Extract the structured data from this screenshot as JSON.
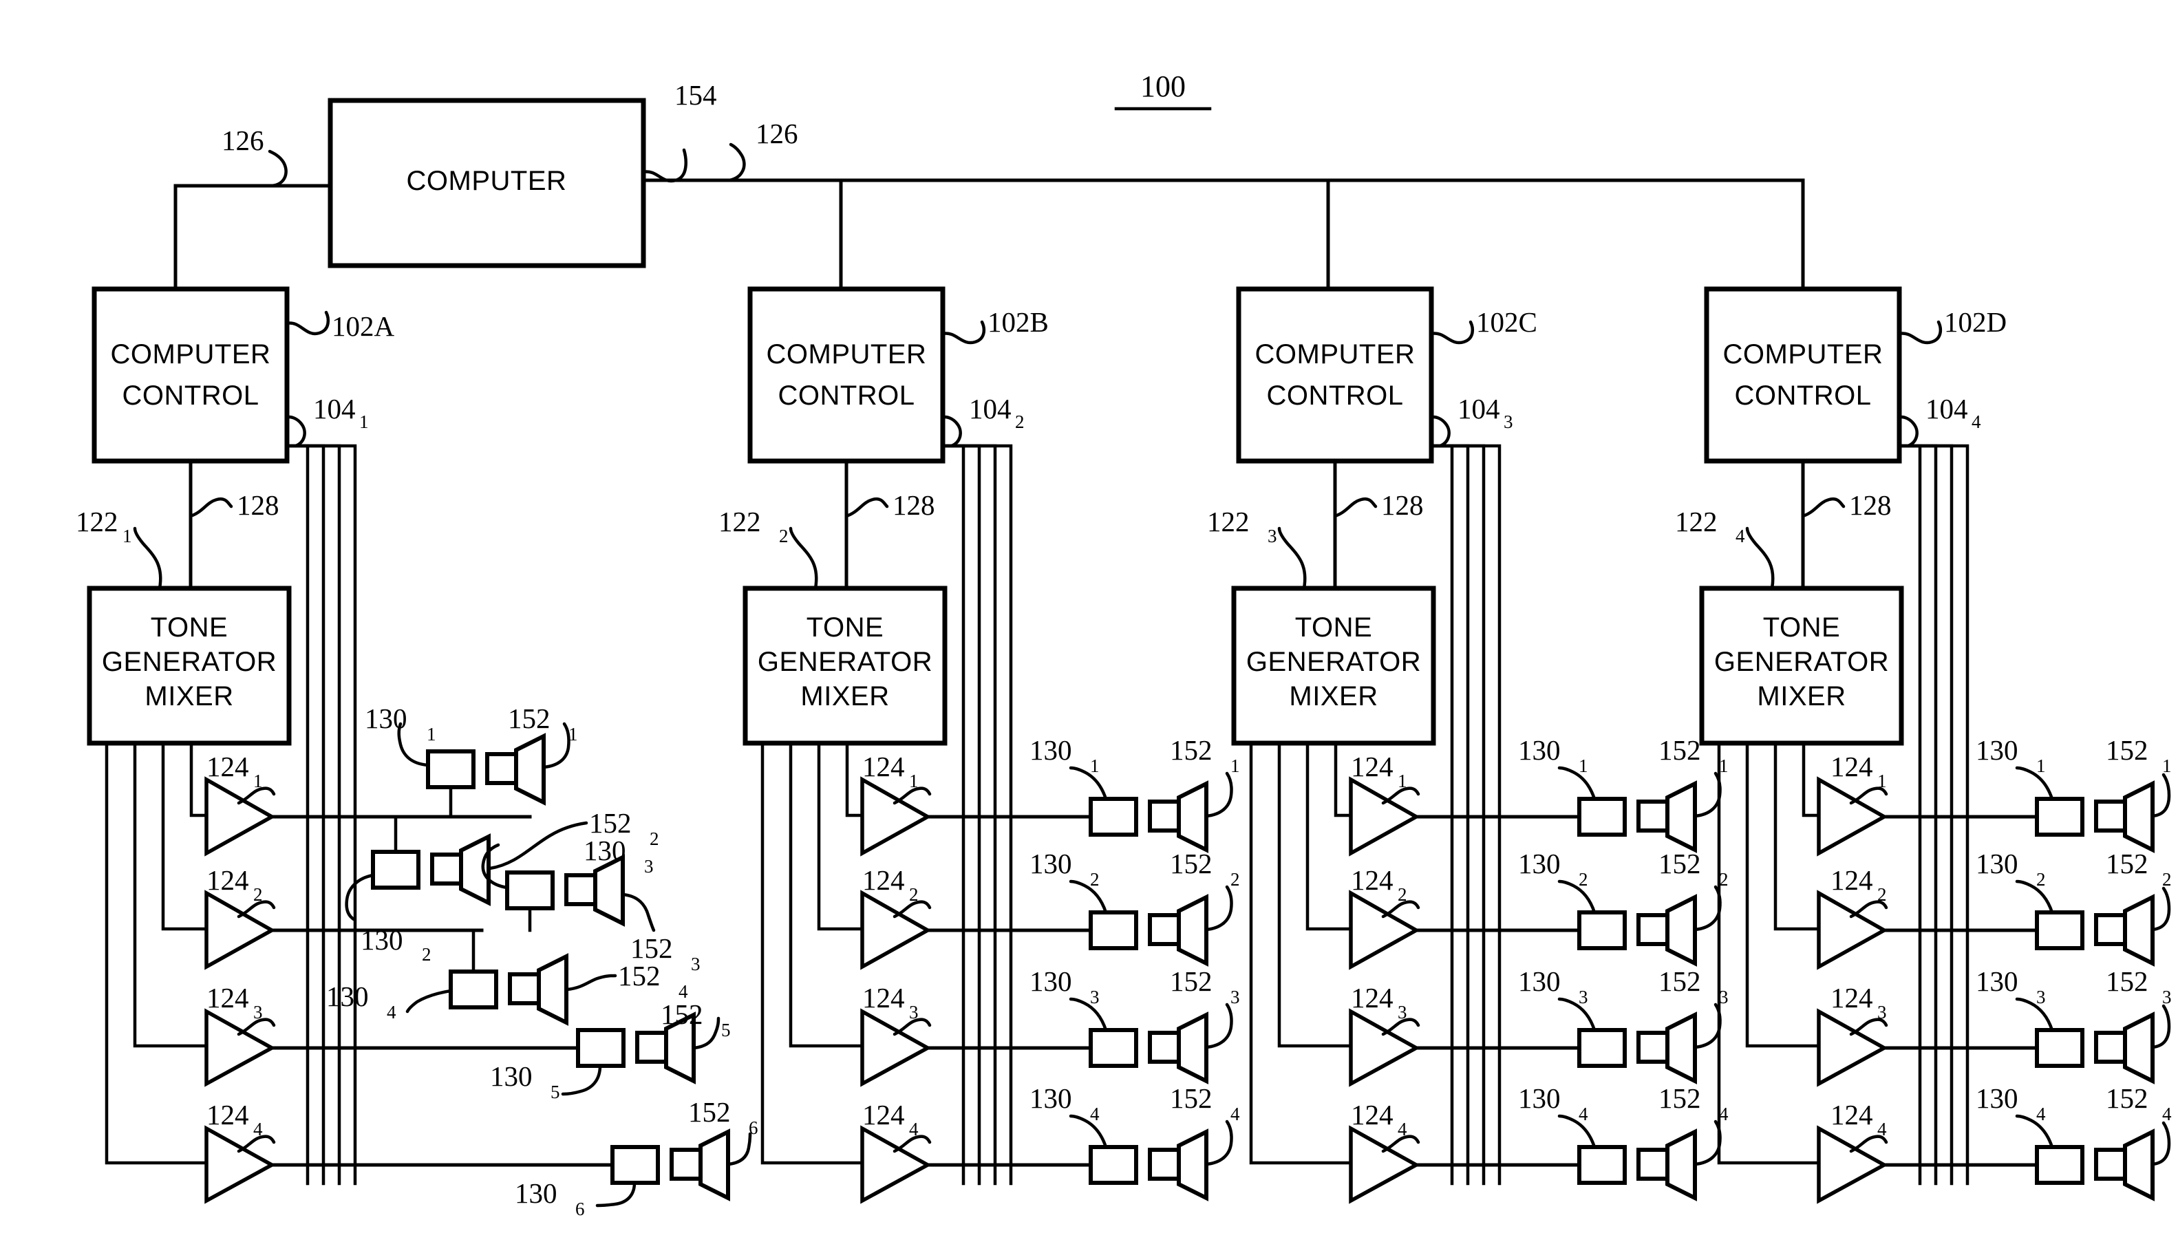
{
  "figure": {
    "number": "100",
    "number_underlined": true,
    "title_text": "100"
  },
  "blocks": {
    "computer": {
      "label": "COMPUTER",
      "ref": "154"
    },
    "computer_control_label_line1": "COMPUTER",
    "computer_control_label_line2": "CONTROL",
    "tone_generator_label_line1": "TONE",
    "tone_generator_label_line2": "GENERATOR",
    "tone_generator_label_line3": "MIXER"
  },
  "bus": {
    "ref_left": "126",
    "ref_right": "126"
  },
  "channels": [
    {
      "id": "A",
      "control_ref": "102A",
      "cable_ref": "104",
      "cable_sub": "1",
      "tone_ref": "122",
      "tone_sub": "1",
      "link_ref": "128",
      "amplifiers": [
        {
          "ref": "124",
          "sub": "1"
        },
        {
          "ref": "124",
          "sub": "2"
        },
        {
          "ref": "124",
          "sub": "3"
        },
        {
          "ref": "124",
          "sub": "4"
        }
      ],
      "transducers": [
        {
          "driver_ref": "130",
          "driver_sub": "1",
          "speaker_ref": "152",
          "speaker_sub": "1"
        },
        {
          "driver_ref": "130",
          "driver_sub": "2",
          "speaker_ref": "152",
          "speaker_sub": "2"
        },
        {
          "driver_ref": "130",
          "driver_sub": "3",
          "speaker_ref": "152",
          "speaker_sub": "3"
        },
        {
          "driver_ref": "130",
          "driver_sub": "4",
          "speaker_ref": "152",
          "speaker_sub": "4"
        },
        {
          "driver_ref": "130",
          "driver_sub": "5",
          "speaker_ref": "152",
          "speaker_sub": "5"
        },
        {
          "driver_ref": "130",
          "driver_sub": "6",
          "speaker_ref": "152",
          "speaker_sub": "6"
        }
      ]
    },
    {
      "id": "B",
      "control_ref": "102B",
      "cable_ref": "104",
      "cable_sub": "2",
      "tone_ref": "122",
      "tone_sub": "2",
      "link_ref": "128",
      "amplifiers": [
        {
          "ref": "124",
          "sub": "1"
        },
        {
          "ref": "124",
          "sub": "2"
        },
        {
          "ref": "124",
          "sub": "3"
        },
        {
          "ref": "124",
          "sub": "4"
        }
      ],
      "transducers": [
        {
          "driver_ref": "130",
          "driver_sub": "1",
          "speaker_ref": "152",
          "speaker_sub": "1"
        },
        {
          "driver_ref": "130",
          "driver_sub": "2",
          "speaker_ref": "152",
          "speaker_sub": "2"
        },
        {
          "driver_ref": "130",
          "driver_sub": "3",
          "speaker_ref": "152",
          "speaker_sub": "3"
        },
        {
          "driver_ref": "130",
          "driver_sub": "4",
          "speaker_ref": "152",
          "speaker_sub": "4"
        }
      ]
    },
    {
      "id": "C",
      "control_ref": "102C",
      "cable_ref": "104",
      "cable_sub": "3",
      "tone_ref": "122",
      "tone_sub": "3",
      "link_ref": "128",
      "amplifiers": [
        {
          "ref": "124",
          "sub": "1"
        },
        {
          "ref": "124",
          "sub": "2"
        },
        {
          "ref": "124",
          "sub": "3"
        },
        {
          "ref": "124",
          "sub": "4"
        }
      ],
      "transducers": [
        {
          "driver_ref": "130",
          "driver_sub": "1",
          "speaker_ref": "152",
          "speaker_sub": "1"
        },
        {
          "driver_ref": "130",
          "driver_sub": "2",
          "speaker_ref": "152",
          "speaker_sub": "2"
        },
        {
          "driver_ref": "130",
          "driver_sub": "3",
          "speaker_ref": "152",
          "speaker_sub": "3"
        },
        {
          "driver_ref": "130",
          "driver_sub": "4",
          "speaker_ref": "152",
          "speaker_sub": "4"
        }
      ]
    },
    {
      "id": "D",
      "control_ref": "102D",
      "cable_ref": "104",
      "cable_sub": "4",
      "tone_ref": "122",
      "tone_sub": "4",
      "link_ref": "128",
      "amplifiers": [
        {
          "ref": "124",
          "sub": "1"
        },
        {
          "ref": "124",
          "sub": "2"
        },
        {
          "ref": "124",
          "sub": "3"
        },
        {
          "ref": "124",
          "sub": "4"
        }
      ],
      "transducers": [
        {
          "driver_ref": "130",
          "driver_sub": "1",
          "speaker_ref": "152",
          "speaker_sub": "1"
        },
        {
          "driver_ref": "130",
          "driver_sub": "2",
          "speaker_ref": "152",
          "speaker_sub": "2"
        },
        {
          "driver_ref": "130",
          "driver_sub": "3",
          "speaker_ref": "152",
          "speaker_sub": "3"
        },
        {
          "driver_ref": "130",
          "driver_sub": "4",
          "speaker_ref": "152",
          "speaker_sub": "4"
        }
      ]
    }
  ],
  "colors": {
    "ink": "#000000",
    "paper": "#ffffff"
  }
}
